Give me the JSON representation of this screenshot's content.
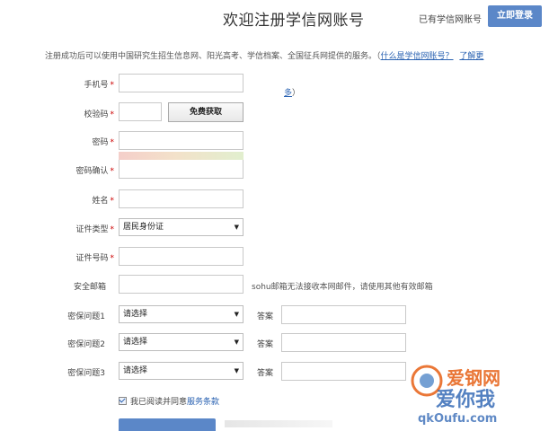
{
  "header": {
    "title": "欢迎注册学信网账号",
    "have_account": "已有学信网账号",
    "login_button": "立即登录"
  },
  "intro": {
    "text": "注册成功后可以使用中国研究生招生信息网、阳光高考、学信档案、全国征兵网提供的服务。（",
    "link_text": "什么是学信网账号？",
    "more_link_a": "了解更",
    "more_link_b": "多",
    "close_paren": "）"
  },
  "form": {
    "phone_label": "手机号",
    "code_label": "校验码",
    "code_button": "免费获取",
    "password_label": "密码",
    "confirm_label": "密码确认",
    "name_label": "姓名",
    "id_type_label": "证件类型",
    "id_type_value": "居民身份证",
    "id_number_label": "证件号码",
    "email_label": "安全邮箱",
    "email_hint": "sohu邮箱无法接收本网邮件，请使用其他有效邮箱",
    "required_mark": "*",
    "questions": [
      {
        "label": "密保问题1",
        "select_value": "请选择",
        "answer_label": "答案"
      },
      {
        "label": "密保问题2",
        "select_value": "请选择",
        "answer_label": "答案"
      },
      {
        "label": "密保问题3",
        "select_value": "请选择",
        "answer_label": "答案"
      }
    ],
    "agree_text": "我已阅读并同意",
    "agree_link": "服务条款"
  },
  "watermark": {
    "text_top": "爱钢网",
    "text_mid": "爱你我",
    "text_bottom": "qkOufu.com",
    "accent": "#e65f14"
  }
}
